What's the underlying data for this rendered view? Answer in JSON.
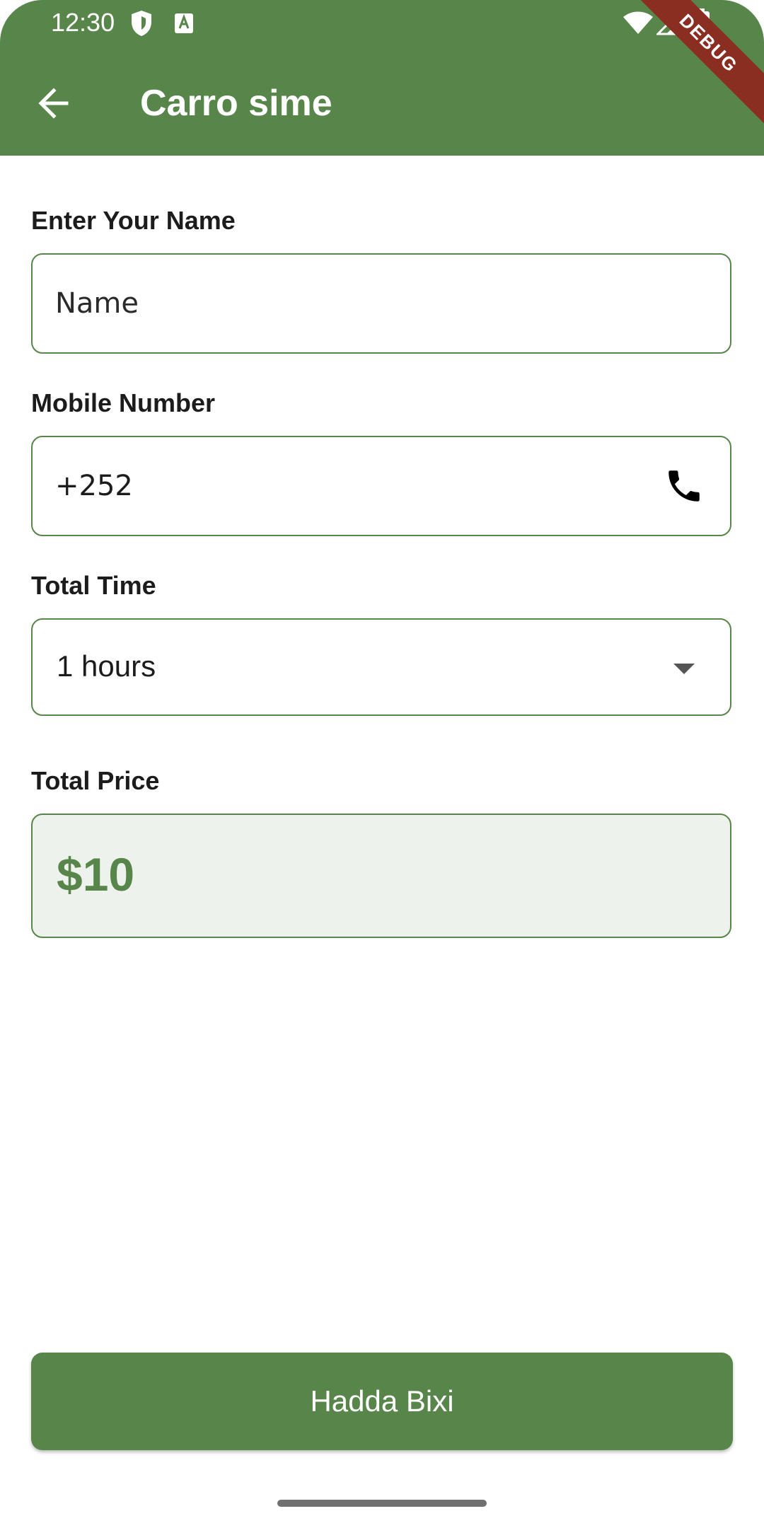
{
  "status_bar": {
    "time": "12:30",
    "icons": [
      "shield-icon",
      "a-notification-icon",
      "wifi-icon",
      "cellular-signal-icon",
      "battery-icon"
    ],
    "debug_label": "DEBUG"
  },
  "app_bar": {
    "back_icon": "arrow-back-icon",
    "title": "Carro sime"
  },
  "form": {
    "name": {
      "label": "Enter Your Name",
      "placeholder": "Name",
      "value": ""
    },
    "mobile": {
      "label": "Mobile Number",
      "value": "+252",
      "icon": "phone-icon"
    },
    "total_time": {
      "label": "Total Time",
      "selected": "1 hours"
    },
    "total_price": {
      "label": "Total Price",
      "value": "$10"
    }
  },
  "submit_label": "Hadda Bixi",
  "colors": {
    "primary": "#57854a",
    "price_background": "#edf2ec",
    "debug_ribbon": "#8b2e22"
  }
}
